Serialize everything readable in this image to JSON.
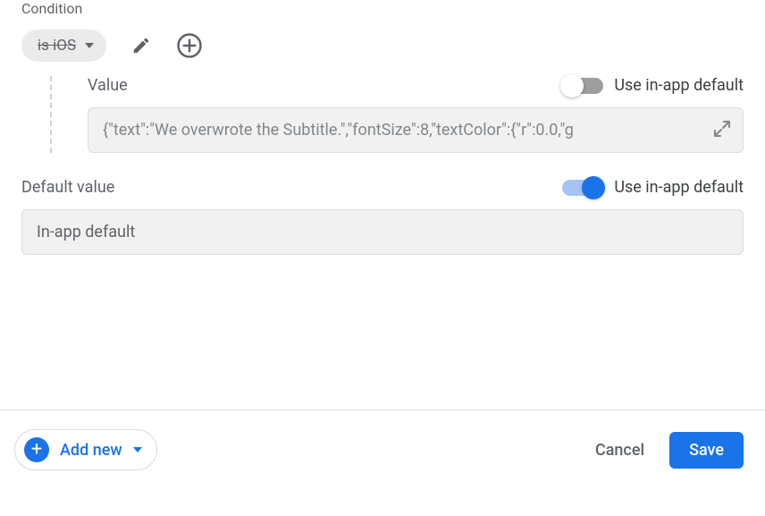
{
  "condition": {
    "section_label": "Condition",
    "chip_text": "is iOS"
  },
  "value_block": {
    "label": "Value",
    "toggle_label": "Use in-app default",
    "toggle_on": false,
    "input_value": "{\"text\":\"We overwrote the Subtitle.\",\"fontSize\":8,\"textColor\":{\"r\":0.0,\"g"
  },
  "default_block": {
    "label": "Default value",
    "toggle_label": "Use in-app default",
    "toggle_on": true,
    "input_value": "In-app default"
  },
  "footer": {
    "add_new_label": "Add new",
    "cancel_label": "Cancel",
    "save_label": "Save"
  }
}
